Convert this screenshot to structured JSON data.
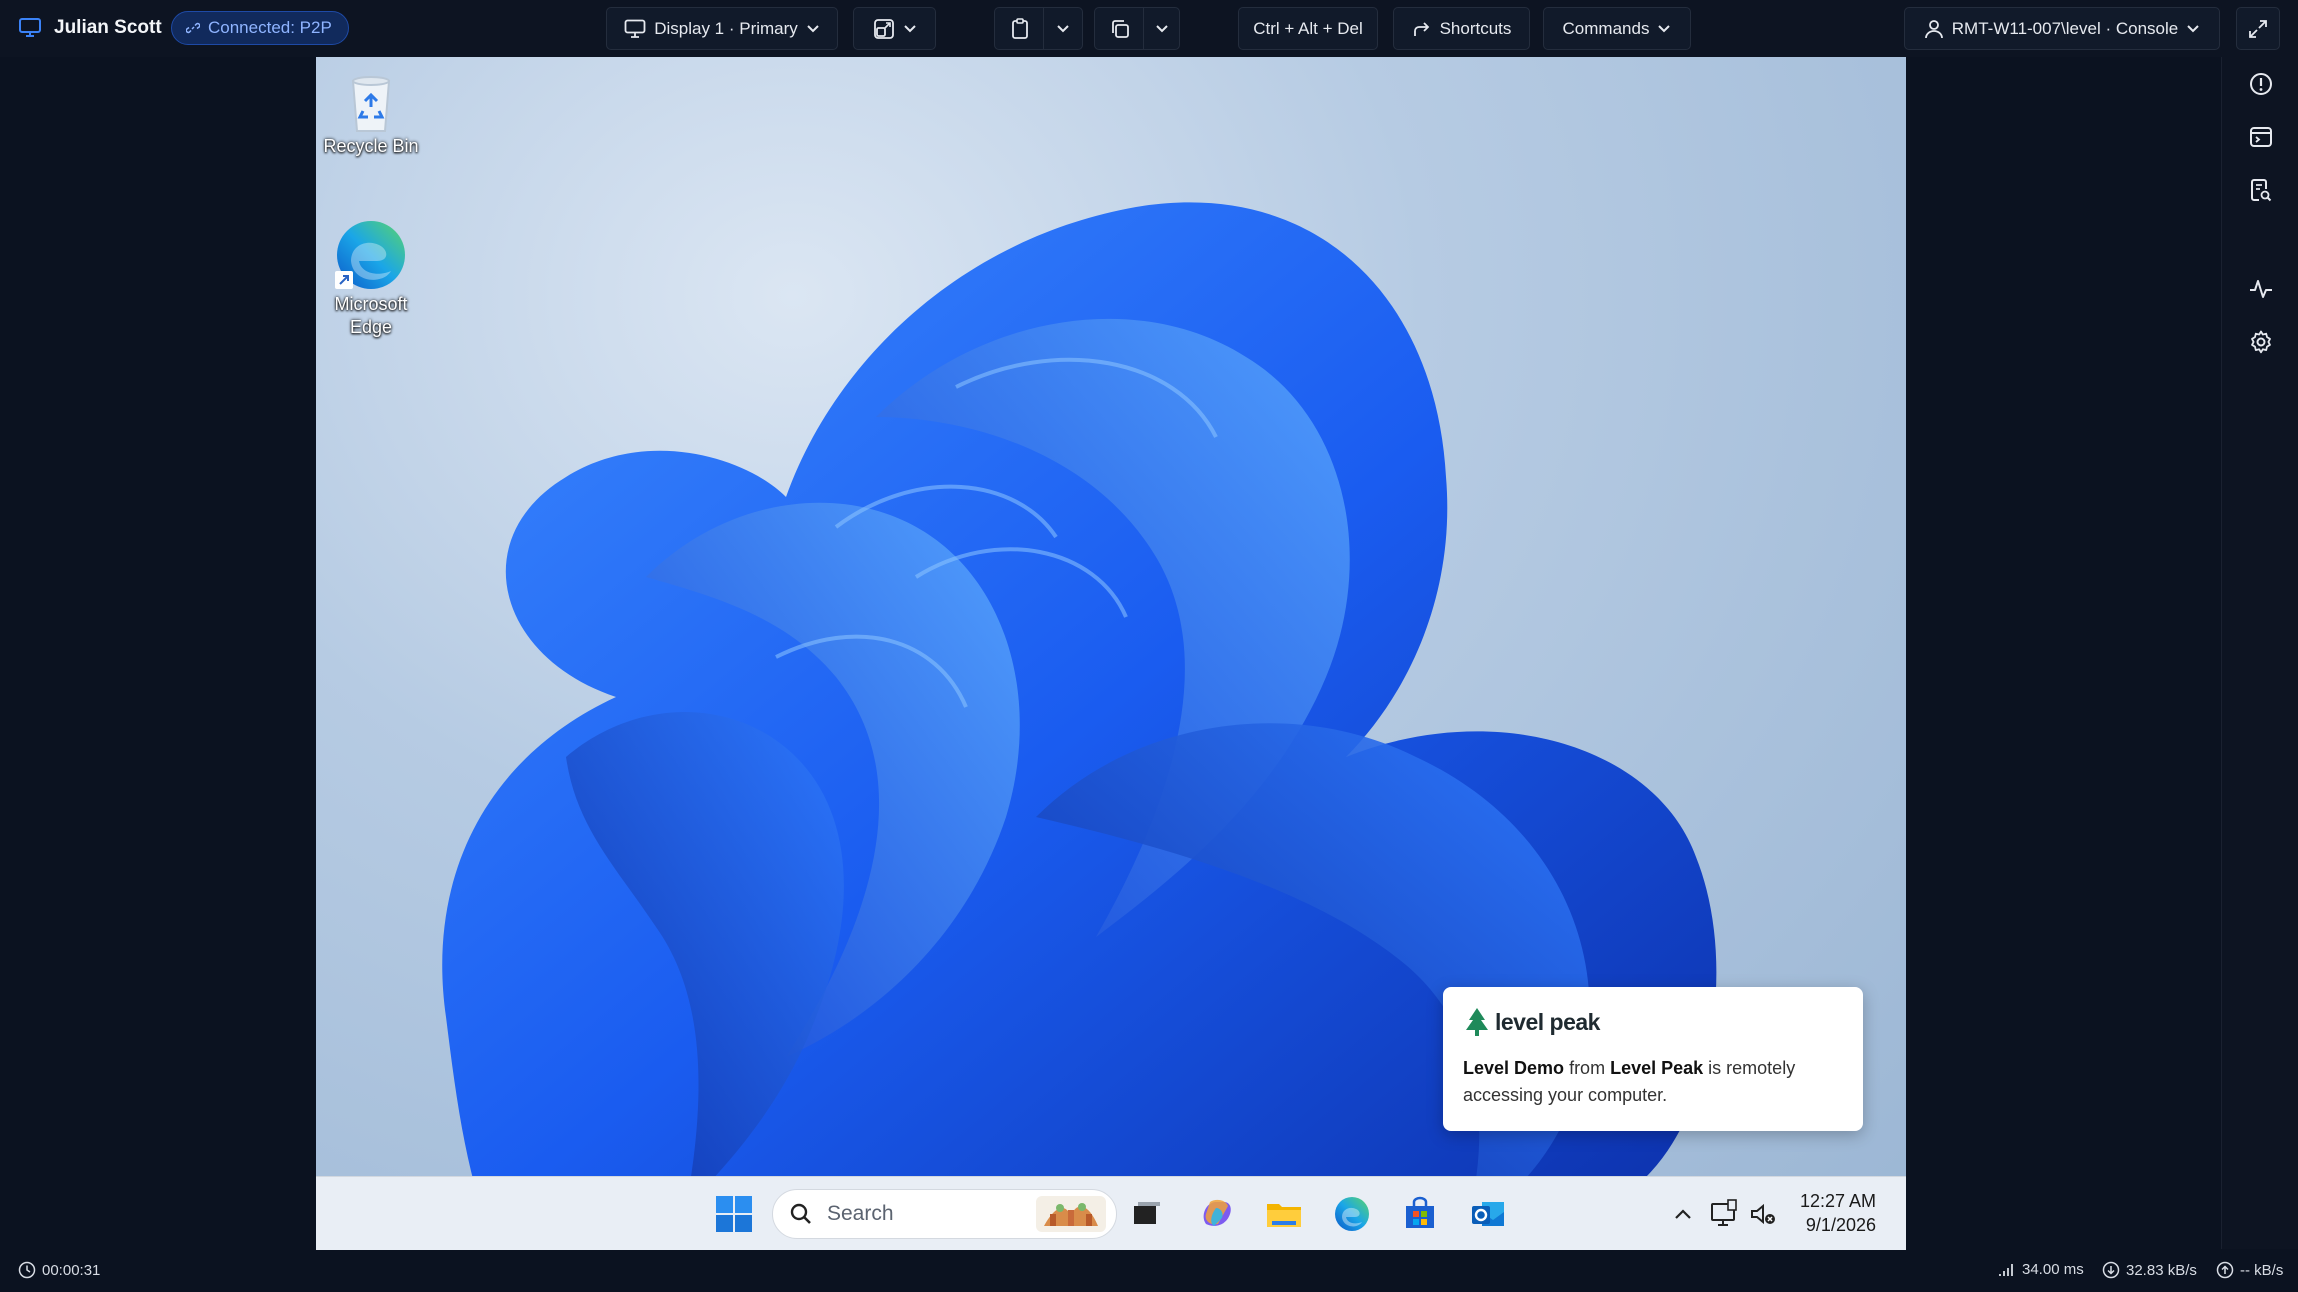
{
  "session": {
    "user_name": "Julian Scott",
    "connection_badge": "Connected: P2P"
  },
  "toolbar": {
    "display_label": "Display 1 · Primary",
    "cad_label": "Ctrl + Alt + Del",
    "shortcuts_label": "Shortcuts",
    "commands_label": "Commands",
    "host_label": "RMT-W11-007\\level · Console"
  },
  "desktop": {
    "icons": [
      {
        "label": "Recycle Bin"
      },
      {
        "label_line1": "Microsoft",
        "label_line2": "Edge"
      }
    ]
  },
  "notification": {
    "brand": "level peak",
    "who": "Level Demo",
    "from_word": "from",
    "org": "Level Peak",
    "rest_line1": "is remotely",
    "rest_line2": "accessing your computer."
  },
  "taskbar": {
    "search_placeholder": "Search",
    "time": "12:27 AM",
    "date": "9/1/2026"
  },
  "status": {
    "elapsed": "00:00:31",
    "latency": "34.00 ms",
    "download": "32.83 kB/s",
    "upload": "-- kB/s"
  },
  "colors": {
    "accent": "#3b82f6",
    "toolbar_bg": "#0d1422",
    "badge_bg": "#112a5c"
  }
}
